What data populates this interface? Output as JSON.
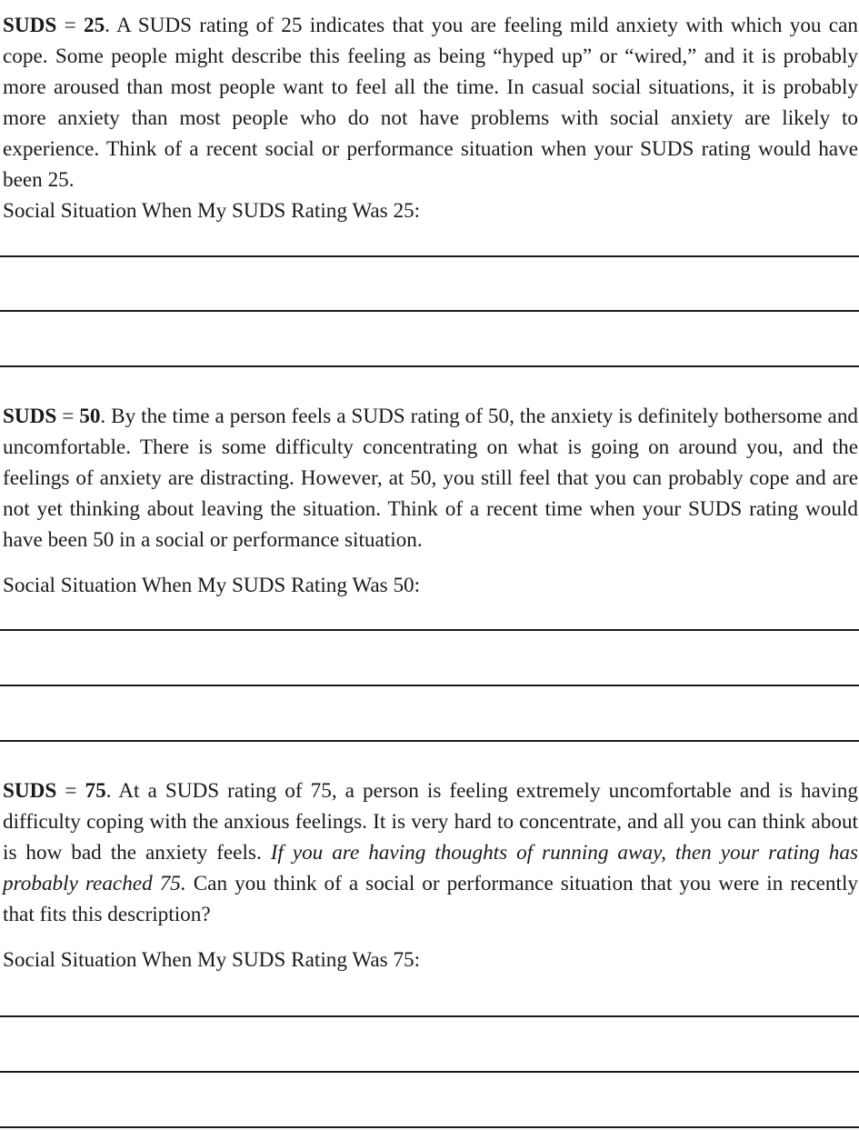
{
  "sections": [
    {
      "label": "SUDS",
      "equals": " = ",
      "value": "25",
      "text": ". A SUDS rating of 25 indicates that you are feeling mild anxiety with which you can cope. Some people might describe this feeling as being “hyped up” or “wired,” and it is probably more aroused than most people want to feel all the time. In casual social situations, it is probably more anxiety than most people who do not have problems with social anxiety are likely to experience. Think of a recent social or performance situation when your SUDS rating would have been 25.",
      "prompt": "Social Situation When My SUDS Rating Was 25:"
    },
    {
      "label": "SUDS",
      "equals": " = ",
      "value": "50",
      "text": ". By the time a person feels a SUDS rating of 50, the anxiety is definitely bothersome and uncomfortable. There is some difficulty concentrating on what is going on around you, and the feelings of anxiety are distracting. However, at 50, you still feel that you can probably cope and are not yet thinking about leaving the situation. Think of a recent time when your SUDS rating would have been 50 in a social or performance situation.",
      "prompt": "Social Situation When My SUDS Rating Was 50:"
    },
    {
      "label": "SUDS",
      "equals": " = ",
      "value": "75",
      "text": ". At a SUDS rating of 75, a person is feeling extremely uncomfortable and is having difficulty coping with the anxious feelings. It is very hard to concentrate, and all you can think about is how bad the anxiety feels. ",
      "italic": "If you are having thoughts of running away, then your rating has probably reached 75.",
      "text_after": " Can you think of a social or performance situation that you were in recently that fits this description?",
      "prompt": "Social Situation When My SUDS Rating Was 75:"
    }
  ]
}
